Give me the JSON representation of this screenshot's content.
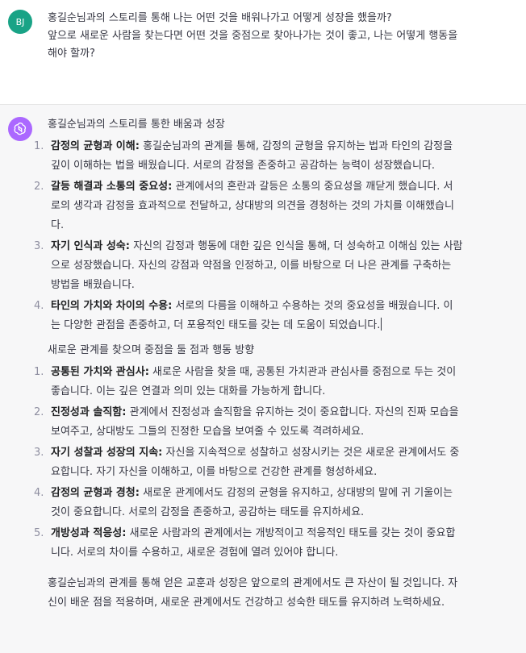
{
  "user": {
    "initials": "BJ",
    "lines": [
      "홍길순님과의 스토리를 통해 나는 어떤 것을 배워나가고 어떻게 성장을 했을까?",
      "앞으로 새로운 사람을 찾는다면 어떤 것을 중점으로 찾아나가는 것이 좋고, 나는 어떻게 행동을",
      "해야 할까?"
    ]
  },
  "assistant": {
    "section1": {
      "heading": "홍길순님과의 스토리를 통한 배움과 성장",
      "items": [
        {
          "num": "1.",
          "title": "감정의 균형과 이해:",
          "first": " 홍길순님과의 관계를 통해, 감정의 균형을 유지하는 법과 타인의 감정을",
          "rest": [
            "깊이 이해하는 법을 배웠습니다. 서로의 감정을 존중하고 공감하는 능력이 성장했습니다."
          ]
        },
        {
          "num": "2.",
          "title": "갈등 해결과 소통의 중요성:",
          "first": " 관계에서의 혼란과 갈등은 소통의 중요성을 깨닫게 했습니다. 서",
          "rest": [
            "로의 생각과 감정을 효과적으로 전달하고, 상대방의 의견을 경청하는 것의 가치를 이해했습니",
            "다."
          ]
        },
        {
          "num": "3.",
          "title": "자기 인식과 성숙:",
          "first": " 자신의 감정과 행동에 대한 깊은 인식을 통해, 더 성숙하고 이해심 있는 사람",
          "rest": [
            "으로 성장했습니다. 자신의 강점과 약점을 인정하고, 이를 바탕으로 더 나은 관계를 구축하는",
            "방법을 배웠습니다."
          ]
        },
        {
          "num": "4.",
          "title": "타인의 가치와 차이의 수용:",
          "first": " 서로의 다름을 이해하고 수용하는 것의 중요성을 배웠습니다. 이",
          "rest": [
            "는 다양한 관점을 존중하고, 더 포용적인 태도를 갖는 데 도움이 되었습니다."
          ]
        }
      ]
    },
    "section2": {
      "heading": "새로운 관계를 찾으며 중점을 둘 점과 행동 방향",
      "items": [
        {
          "num": "1.",
          "title": "공통된 가치와 관심사:",
          "first": " 새로운 사람을 찾을 때, 공통된 가치관과 관심사를 중점으로 두는 것이",
          "rest": [
            "좋습니다. 이는 깊은 연결과 의미 있는 대화를 가능하게 합니다."
          ]
        },
        {
          "num": "2.",
          "title": "진정성과 솔직함:",
          "first": " 관계에서 진정성과 솔직함을 유지하는 것이 중요합니다. 자신의 진짜 모습을",
          "rest": [
            "보여주고, 상대방도 그들의 진정한 모습을 보여줄 수 있도록 격려하세요."
          ]
        },
        {
          "num": "3.",
          "title": "자기 성찰과 성장의 지속:",
          "first": " 자신을 지속적으로 성찰하고 성장시키는 것은 새로운 관계에서도 중",
          "rest": [
            "요합니다. 자기 자신을 이해하고, 이를 바탕으로 건강한 관계를 형성하세요."
          ]
        },
        {
          "num": "4.",
          "title": "감정의 균형과 경청:",
          "first": " 새로운 관계에서도 감정의 균형을 유지하고, 상대방의 말에 귀 기울이는",
          "rest": [
            "것이 중요합니다. 서로의 감정을 존중하고, 공감하는 태도를 유지하세요."
          ]
        },
        {
          "num": "5.",
          "title": "개방성과 적응성:",
          "first": " 새로운 사람과의 관계에서는 개방적이고 적응적인 태도를 갖는 것이 중요합",
          "rest": [
            "니다. 서로의 차이를 수용하고, 새로운 경험에 열려 있어야 합니다."
          ]
        }
      ]
    },
    "closing": [
      "홍길순님과의 관계를 통해 얻은 교훈과 성장은 앞으로의 관계에서도 큰 자산이 될 것입니다. 자",
      "신이 배운 점을 적용하며, 새로운 관계에서도 건강하고 성숙한 태도를 유지하려 노력하세요."
    ]
  }
}
